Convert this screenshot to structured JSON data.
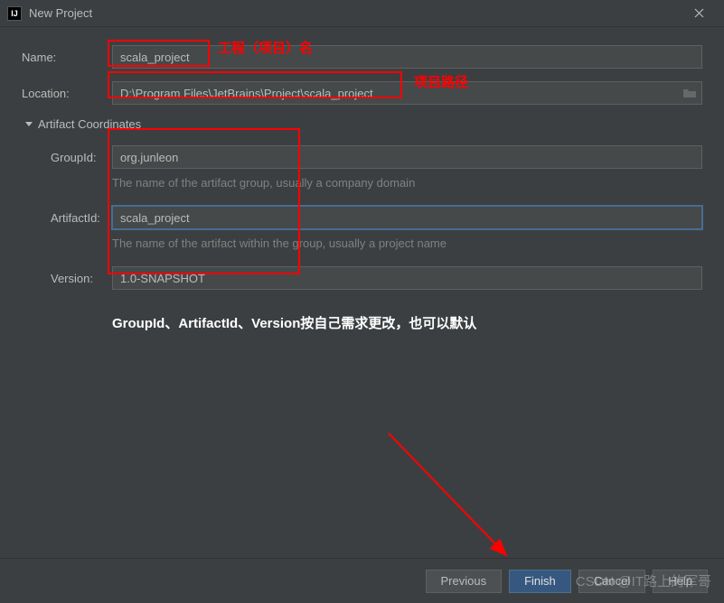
{
  "window": {
    "title": "New Project",
    "app_icon_text": "IJ"
  },
  "form": {
    "name_label": "Name:",
    "name_value": "scala_project",
    "location_label": "Location:",
    "location_value": "D:\\Program Files\\JetBrains\\Project\\scala_project",
    "section_title": "Artifact Coordinates",
    "groupid_label": "GroupId:",
    "groupid_value": "org.junleon",
    "groupid_hint": "The name of the artifact group, usually a company domain",
    "artifactid_label": "ArtifactId:",
    "artifactid_value": "scala_project",
    "artifactid_hint": "The name of the artifact within the group, usually a project name",
    "version_label": "Version:",
    "version_value": "1.0-SNAPSHOT"
  },
  "annotations": {
    "project_name": "工程（项目）名",
    "project_path": "项目路径",
    "note": "GroupId、ArtifactId、Version按自己需求更改，也可以默认"
  },
  "buttons": {
    "previous": "Previous",
    "finish": "Finish",
    "cancel": "Cancel",
    "help": "Help"
  },
  "watermark": "CSDN @IT路上的军哥"
}
